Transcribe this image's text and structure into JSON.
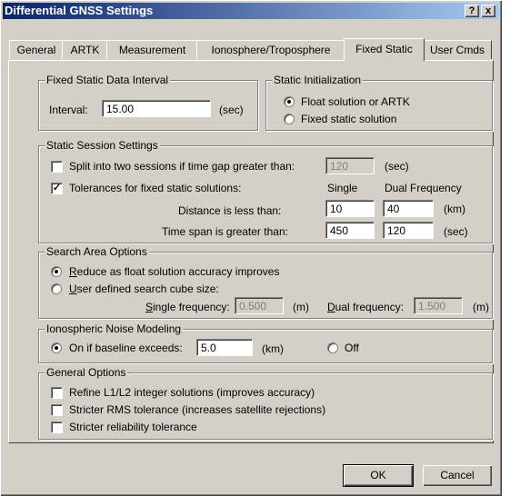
{
  "window": {
    "title": "Differential GNSS Settings",
    "help_label": "?",
    "close_label": "x"
  },
  "tabs": [
    "General",
    "ARTK",
    "Measurement",
    "Ionosphere/Troposphere",
    "Fixed Static",
    "User Cmds"
  ],
  "fixed_static_interval": {
    "label": "Fixed Static Data Interval",
    "interval_label": "Interval:",
    "value": "15.00",
    "unit": "(sec)"
  },
  "static_init": {
    "label": "Static Initialization",
    "option1": "Float solution or ARTK",
    "option2": "Fixed static solution",
    "selected": "option1"
  },
  "session": {
    "label": "Static Session Settings",
    "split_label": "Split into two sessions if time gap greater than:",
    "split_checked": false,
    "split_value": "120",
    "split_unit": "(sec)",
    "tol_label": "Tolerances for fixed static solutions:",
    "tol_checked": true,
    "col_single": "Single",
    "col_dual": "Dual Frequency",
    "distance_label": "Distance is less than:",
    "distance_single": "10",
    "distance_dual": "40",
    "distance_unit": "(km)",
    "time_label": "Time span is greater than:",
    "time_single": "450",
    "time_dual": "120",
    "time_unit": "(sec)"
  },
  "search": {
    "label": "Search Area Options",
    "option1_prefix": "R",
    "option1_rest": "educe as float solution accuracy improves",
    "option2_prefix": "U",
    "option2_rest": "ser defined search cube size:",
    "selected": "option1",
    "single_prefix": "S",
    "single_rest": "ingle frequency:",
    "single_value": "0.500",
    "single_unit": "(m)",
    "dual_prefix": "D",
    "dual_rest": "ual frequency:",
    "dual_value": "1.500",
    "dual_unit": "(m)"
  },
  "iono": {
    "label": "Ionospheric Noise Modeling",
    "on_label": "On if baseline exceeds:",
    "value": "5.0",
    "unit": "(km)",
    "off_label": "Off",
    "selected": "on"
  },
  "general": {
    "label": "General Options",
    "opt1": "Refine L1/L2 integer solutions (improves accuracy)",
    "opt2": "Stricter RMS tolerance (increases satellite rejections)",
    "opt3": "Stricter reliability tolerance"
  },
  "buttons": {
    "ok": "OK",
    "cancel": "Cancel"
  }
}
